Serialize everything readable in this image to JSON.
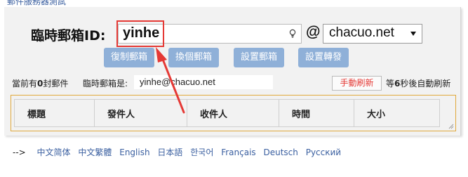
{
  "page": {
    "top_cut_text": "郵件服務器測試"
  },
  "form": {
    "id_label": "臨時郵箱ID:",
    "email_value": "yinhe",
    "at_sign": "@",
    "domain_selected": "chacuo.net"
  },
  "actions": {
    "copy_label": "復制郵箱",
    "switch_label": "換個郵箱",
    "set_label": "設置郵箱",
    "forward_label": "設置轉發"
  },
  "status": {
    "count_prefix": "當前有",
    "count_value": "0",
    "count_suffix": "封郵件",
    "address_label": "臨時郵箱是:",
    "address_value": "yinhe@chacuo.net",
    "refresh_label": "手動刷新",
    "timer_prefix": "等",
    "timer_value": "6",
    "timer_suffix": "秒後自動刷新"
  },
  "mail_table": {
    "columns": [
      "標題",
      "發件人",
      "收件人",
      "時間",
      "大小"
    ]
  },
  "languages": {
    "arrow": "-->",
    "items": [
      "中文简体",
      "中文繁體",
      "English",
      "日本語",
      "한국어",
      "Français",
      "Deutsch",
      "Русский"
    ]
  },
  "colors": {
    "accent_button": "#8fb0d8",
    "highlight": "#e53935",
    "link": "#3a5fa0",
    "frame": "#e0a83a"
  }
}
